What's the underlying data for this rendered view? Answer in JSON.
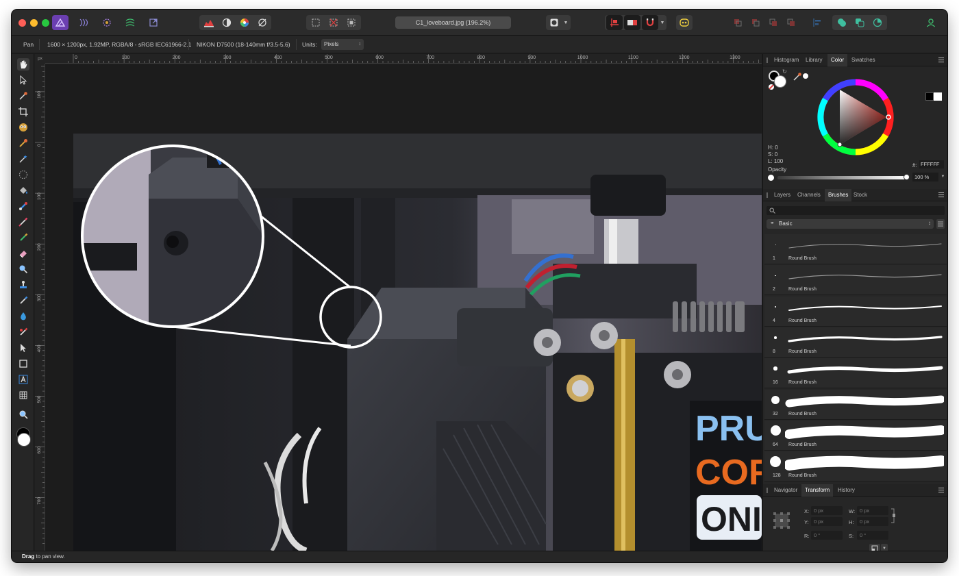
{
  "document": {
    "title": "C1_loveboard.jpg (196.2%)"
  },
  "context_bar": {
    "tool_name": "Pan",
    "image_info": "1600 × 1200px, 1.92MP, RGBA/8 - sRGB IEC61966-2.1",
    "camera_info": "NIKON D7500 (18-140mm f/3.5-5.6)",
    "units_label": "Units:",
    "units_value": "Pixels"
  },
  "ruler": {
    "unit": "px",
    "top_labels": [
      "0",
      "100",
      "200",
      "300",
      "400",
      "500",
      "600",
      "700",
      "800",
      "900",
      "1000",
      "1100",
      "1200",
      "1300"
    ],
    "left_labels": [
      "100",
      "0",
      "100",
      "200",
      "300",
      "400",
      "500",
      "600",
      "700"
    ]
  },
  "color_panel": {
    "tabs": [
      "Histogram",
      "Library",
      "Color",
      "Swatches"
    ],
    "active_tab": "Color",
    "h": "H: 0",
    "s": "S: 0",
    "l": "L: 100",
    "hex_label": "#:",
    "hex_value": "FFFFFF",
    "opacity_label": "Opacity",
    "opacity_value": "100 %",
    "accent": "#e0392f"
  },
  "brushes_panel": {
    "tabs": [
      "Layers",
      "Channels",
      "Brushes",
      "Stock"
    ],
    "active_tab": "Brushes",
    "category": "Basic",
    "brushes": [
      {
        "size": "1",
        "name": "Round Brush"
      },
      {
        "size": "2",
        "name": "Round Brush"
      },
      {
        "size": "4",
        "name": "Round Brush"
      },
      {
        "size": "8",
        "name": "Round Brush"
      },
      {
        "size": "16",
        "name": "Round Brush"
      },
      {
        "size": "32",
        "name": "Round Brush"
      },
      {
        "size": "64",
        "name": "Round Brush"
      },
      {
        "size": "128",
        "name": "Round Brush"
      }
    ]
  },
  "transform_panel": {
    "tabs": [
      "Navigator",
      "Transform",
      "History"
    ],
    "active_tab": "Transform",
    "x_label": "X:",
    "x_value": "0 px",
    "y_label": "Y:",
    "y_value": "0 px",
    "w_label": "W:",
    "w_value": "0 px",
    "h_label": "H:",
    "h_value": "0 px",
    "r_label": "R:",
    "r_value": "0 °",
    "s_label": "S:",
    "s_value": "0 °"
  },
  "photo": {
    "sign_line1": "PRU",
    "sign_line2": "COF",
    "sign_line3": "ONI"
  },
  "status": {
    "bold": "Drag",
    "rest": " to pan view."
  }
}
